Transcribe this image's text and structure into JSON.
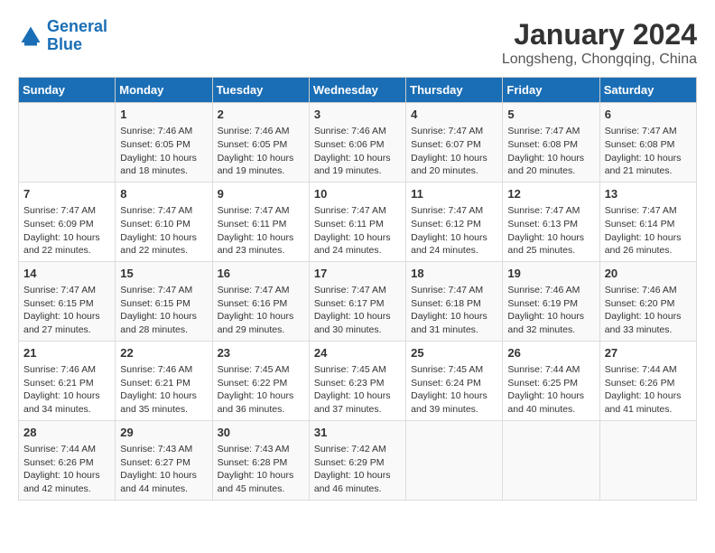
{
  "header": {
    "logo_line1": "General",
    "logo_line2": "Blue",
    "title": "January 2024",
    "subtitle": "Longsheng, Chongqing, China"
  },
  "days_of_week": [
    "Sunday",
    "Monday",
    "Tuesday",
    "Wednesday",
    "Thursday",
    "Friday",
    "Saturday"
  ],
  "weeks": [
    [
      {
        "day": "",
        "sunrise": "",
        "sunset": "",
        "daylight": ""
      },
      {
        "day": "1",
        "sunrise": "Sunrise: 7:46 AM",
        "sunset": "Sunset: 6:05 PM",
        "daylight": "Daylight: 10 hours and 18 minutes."
      },
      {
        "day": "2",
        "sunrise": "Sunrise: 7:46 AM",
        "sunset": "Sunset: 6:05 PM",
        "daylight": "Daylight: 10 hours and 19 minutes."
      },
      {
        "day": "3",
        "sunrise": "Sunrise: 7:46 AM",
        "sunset": "Sunset: 6:06 PM",
        "daylight": "Daylight: 10 hours and 19 minutes."
      },
      {
        "day": "4",
        "sunrise": "Sunrise: 7:47 AM",
        "sunset": "Sunset: 6:07 PM",
        "daylight": "Daylight: 10 hours and 20 minutes."
      },
      {
        "day": "5",
        "sunrise": "Sunrise: 7:47 AM",
        "sunset": "Sunset: 6:08 PM",
        "daylight": "Daylight: 10 hours and 20 minutes."
      },
      {
        "day": "6",
        "sunrise": "Sunrise: 7:47 AM",
        "sunset": "Sunset: 6:08 PM",
        "daylight": "Daylight: 10 hours and 21 minutes."
      }
    ],
    [
      {
        "day": "7",
        "sunrise": "Sunrise: 7:47 AM",
        "sunset": "Sunset: 6:09 PM",
        "daylight": "Daylight: 10 hours and 22 minutes."
      },
      {
        "day": "8",
        "sunrise": "Sunrise: 7:47 AM",
        "sunset": "Sunset: 6:10 PM",
        "daylight": "Daylight: 10 hours and 22 minutes."
      },
      {
        "day": "9",
        "sunrise": "Sunrise: 7:47 AM",
        "sunset": "Sunset: 6:11 PM",
        "daylight": "Daylight: 10 hours and 23 minutes."
      },
      {
        "day": "10",
        "sunrise": "Sunrise: 7:47 AM",
        "sunset": "Sunset: 6:11 PM",
        "daylight": "Daylight: 10 hours and 24 minutes."
      },
      {
        "day": "11",
        "sunrise": "Sunrise: 7:47 AM",
        "sunset": "Sunset: 6:12 PM",
        "daylight": "Daylight: 10 hours and 24 minutes."
      },
      {
        "day": "12",
        "sunrise": "Sunrise: 7:47 AM",
        "sunset": "Sunset: 6:13 PM",
        "daylight": "Daylight: 10 hours and 25 minutes."
      },
      {
        "day": "13",
        "sunrise": "Sunrise: 7:47 AM",
        "sunset": "Sunset: 6:14 PM",
        "daylight": "Daylight: 10 hours and 26 minutes."
      }
    ],
    [
      {
        "day": "14",
        "sunrise": "Sunrise: 7:47 AM",
        "sunset": "Sunset: 6:15 PM",
        "daylight": "Daylight: 10 hours and 27 minutes."
      },
      {
        "day": "15",
        "sunrise": "Sunrise: 7:47 AM",
        "sunset": "Sunset: 6:15 PM",
        "daylight": "Daylight: 10 hours and 28 minutes."
      },
      {
        "day": "16",
        "sunrise": "Sunrise: 7:47 AM",
        "sunset": "Sunset: 6:16 PM",
        "daylight": "Daylight: 10 hours and 29 minutes."
      },
      {
        "day": "17",
        "sunrise": "Sunrise: 7:47 AM",
        "sunset": "Sunset: 6:17 PM",
        "daylight": "Daylight: 10 hours and 30 minutes."
      },
      {
        "day": "18",
        "sunrise": "Sunrise: 7:47 AM",
        "sunset": "Sunset: 6:18 PM",
        "daylight": "Daylight: 10 hours and 31 minutes."
      },
      {
        "day": "19",
        "sunrise": "Sunrise: 7:46 AM",
        "sunset": "Sunset: 6:19 PM",
        "daylight": "Daylight: 10 hours and 32 minutes."
      },
      {
        "day": "20",
        "sunrise": "Sunrise: 7:46 AM",
        "sunset": "Sunset: 6:20 PM",
        "daylight": "Daylight: 10 hours and 33 minutes."
      }
    ],
    [
      {
        "day": "21",
        "sunrise": "Sunrise: 7:46 AM",
        "sunset": "Sunset: 6:21 PM",
        "daylight": "Daylight: 10 hours and 34 minutes."
      },
      {
        "day": "22",
        "sunrise": "Sunrise: 7:46 AM",
        "sunset": "Sunset: 6:21 PM",
        "daylight": "Daylight: 10 hours and 35 minutes."
      },
      {
        "day": "23",
        "sunrise": "Sunrise: 7:45 AM",
        "sunset": "Sunset: 6:22 PM",
        "daylight": "Daylight: 10 hours and 36 minutes."
      },
      {
        "day": "24",
        "sunrise": "Sunrise: 7:45 AM",
        "sunset": "Sunset: 6:23 PM",
        "daylight": "Daylight: 10 hours and 37 minutes."
      },
      {
        "day": "25",
        "sunrise": "Sunrise: 7:45 AM",
        "sunset": "Sunset: 6:24 PM",
        "daylight": "Daylight: 10 hours and 39 minutes."
      },
      {
        "day": "26",
        "sunrise": "Sunrise: 7:44 AM",
        "sunset": "Sunset: 6:25 PM",
        "daylight": "Daylight: 10 hours and 40 minutes."
      },
      {
        "day": "27",
        "sunrise": "Sunrise: 7:44 AM",
        "sunset": "Sunset: 6:26 PM",
        "daylight": "Daylight: 10 hours and 41 minutes."
      }
    ],
    [
      {
        "day": "28",
        "sunrise": "Sunrise: 7:44 AM",
        "sunset": "Sunset: 6:26 PM",
        "daylight": "Daylight: 10 hours and 42 minutes."
      },
      {
        "day": "29",
        "sunrise": "Sunrise: 7:43 AM",
        "sunset": "Sunset: 6:27 PM",
        "daylight": "Daylight: 10 hours and 44 minutes."
      },
      {
        "day": "30",
        "sunrise": "Sunrise: 7:43 AM",
        "sunset": "Sunset: 6:28 PM",
        "daylight": "Daylight: 10 hours and 45 minutes."
      },
      {
        "day": "31",
        "sunrise": "Sunrise: 7:42 AM",
        "sunset": "Sunset: 6:29 PM",
        "daylight": "Daylight: 10 hours and 46 minutes."
      },
      {
        "day": "",
        "sunrise": "",
        "sunset": "",
        "daylight": ""
      },
      {
        "day": "",
        "sunrise": "",
        "sunset": "",
        "daylight": ""
      },
      {
        "day": "",
        "sunrise": "",
        "sunset": "",
        "daylight": ""
      }
    ]
  ]
}
